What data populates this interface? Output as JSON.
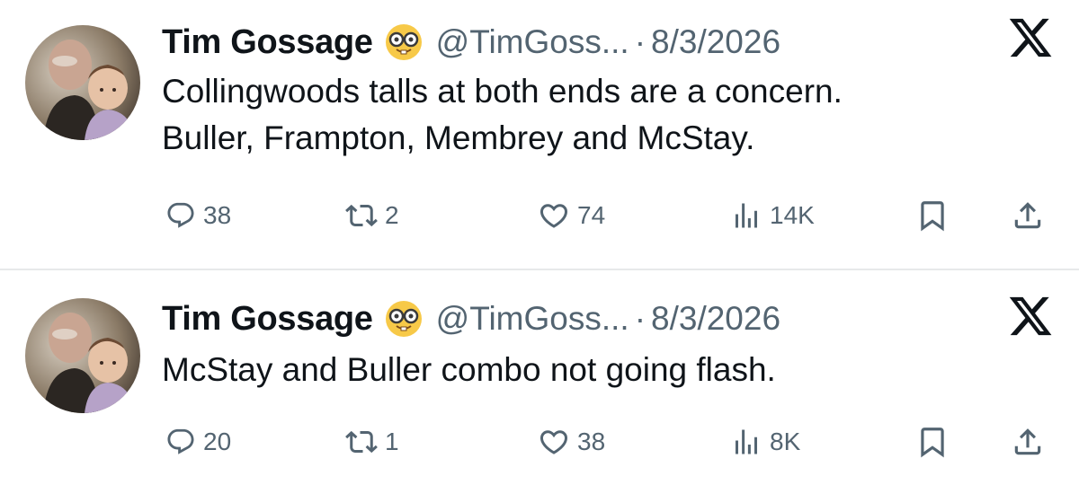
{
  "tweets": [
    {
      "author": {
        "name": "Tim Gossage",
        "badge_icon": "nerd-face-emoji",
        "handle": "@TimGoss...",
        "separator": "·",
        "date": "8/3/2026"
      },
      "text_lines": [
        "Collingwoods talls at both ends are a concern.",
        "Buller, Frampton, Membrey and McStay."
      ],
      "metrics": {
        "replies": "38",
        "retweets": "2",
        "likes": "74",
        "views": "14K"
      }
    },
    {
      "author": {
        "name": "Tim Gossage",
        "badge_icon": "nerd-face-emoji",
        "handle": "@TimGoss...",
        "separator": "·",
        "date": "8/3/2026"
      },
      "text_lines": [
        "McStay and Buller combo not going flash."
      ],
      "metrics": {
        "replies": "20",
        "retweets": "1",
        "likes": "38",
        "views": "8K"
      }
    }
  ],
  "icons": {
    "reply": "reply-icon",
    "retweet": "retweet-icon",
    "like": "heart-icon",
    "views": "views-icon",
    "bookmark": "bookmark-icon",
    "share": "share-icon",
    "brand": "x-logo-icon"
  },
  "colors": {
    "text_primary": "#0f1419",
    "text_secondary": "#536471",
    "divider": "#e7e9ea",
    "background": "#ffffff"
  }
}
